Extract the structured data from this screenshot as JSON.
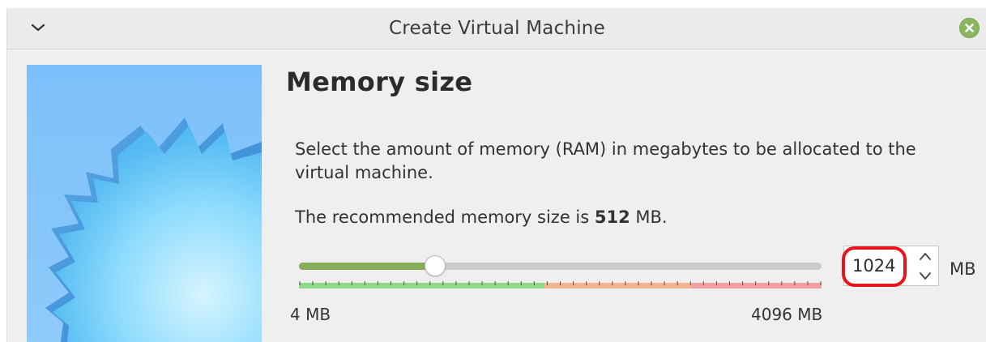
{
  "window": {
    "title": "Create Virtual Machine",
    "icons": {
      "menu": "chevron-down-icon",
      "close": "close-icon"
    }
  },
  "page": {
    "heading": "Memory size",
    "description": "Select the amount of memory (RAM) in megabytes to be allocated to the virtual machine.",
    "recommend_prefix": "The recommended memory size is ",
    "recommend_value": "512",
    "recommend_suffix": " MB."
  },
  "memory": {
    "min_label": "4 MB",
    "max_label": "4096 MB",
    "value": "1024",
    "unit": "MB",
    "min_value": 4,
    "max_value": 4096,
    "slider_fraction": 0.25,
    "zone_colors": {
      "green": "#8fd98a",
      "orange": "#f2b48f",
      "red": "#f0a0a0"
    }
  },
  "colors": {
    "accent_green": "#86ad5a",
    "close_button": "#8ab662",
    "highlight_ring": "#e8141b"
  }
}
